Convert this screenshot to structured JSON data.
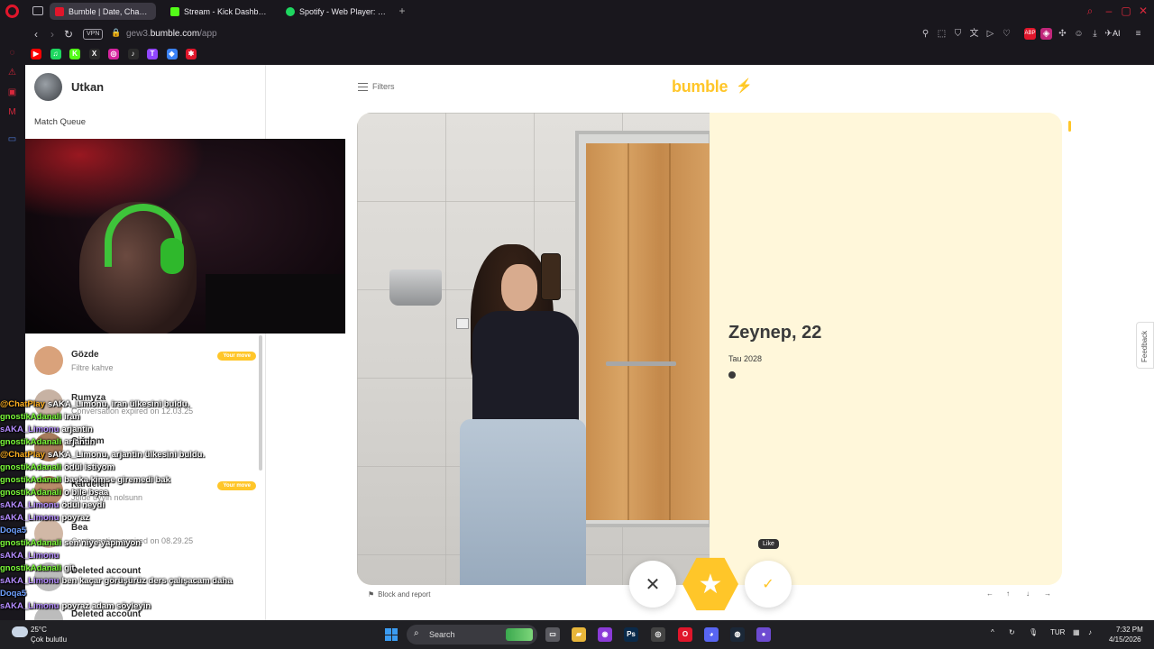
{
  "browser": {
    "tabs": [
      {
        "label": "Bumble | Date, Chat, Meet",
        "favicon_color": "#e0162b",
        "active": true
      },
      {
        "label": "Stream - Kick Dashboard",
        "favicon_color": "#53fc18",
        "active": false
      },
      {
        "label": "Spotify - Web Player: Her",
        "favicon_color": "#1ed760",
        "active": false
      }
    ],
    "vpn_label": "VPN",
    "url_prefix": "gew3.",
    "url_domain": "bumble.com",
    "url_path": "/app",
    "ai_label": "AI",
    "toolbar_icons": [
      "pin-icon",
      "snapshot-icon",
      "shield-icon",
      "translate-icon",
      "play-icon",
      "heart-icon",
      "abp-extension-icon",
      "extension-icon",
      "puzzle-icon",
      "profile-icon",
      "download-icon",
      "aria-icon",
      "menu-icon"
    ],
    "bookmarks": [
      {
        "name": "youtube-icon",
        "color": "#ff0000",
        "glyph": "▶"
      },
      {
        "name": "spotify-icon",
        "color": "#1ed760",
        "glyph": "♫"
      },
      {
        "name": "kick-icon",
        "color": "#53fc18",
        "glyph": "K"
      },
      {
        "name": "x-icon",
        "color": "#2a2a2a",
        "glyph": "X"
      },
      {
        "name": "instagram-icon",
        "color": "#d6249f",
        "glyph": "◎"
      },
      {
        "name": "tiktok-icon",
        "color": "#2a2a2a",
        "glyph": "♪"
      },
      {
        "name": "twitch-icon",
        "color": "#9146ff",
        "glyph": "T"
      },
      {
        "name": "ai-bookmark-icon",
        "color": "#3b82f6",
        "glyph": "◆"
      },
      {
        "name": "app-bookmark-icon",
        "color": "#e0162b",
        "glyph": "✱"
      }
    ]
  },
  "sidebar": {
    "user_name": "Utkan",
    "match_queue_label": "Match Queue",
    "conversations": [
      {
        "name": "Gözde",
        "subtitle": "Filtre kahve",
        "badge": "Your move",
        "avatar_color": "#d9a27b"
      },
      {
        "name": "Rumyza",
        "subtitle": "Conversation expired on 12.03.25",
        "badge": "",
        "avatar_color": "#c7b2a3"
      },
      {
        "name": "Çiğdem",
        "subtitle": "",
        "badge": "",
        "avatar_color": "#a67b5b"
      },
      {
        "name": "Kardelen",
        "subtitle": "Jolde uyyih nolsunn",
        "badge": "Your move",
        "avatar_color": "#b88b6a"
      },
      {
        "name": "Bea",
        "subtitle": "Conversation expired on 08.29.25",
        "badge": "",
        "avatar_color": "#d1b8a6"
      },
      {
        "name": "Deleted account",
        "subtitle": "",
        "badge": "",
        "avatar_color": "#bcbcbc"
      },
      {
        "name": "Deleted account",
        "subtitle": "",
        "badge": "",
        "avatar_color": "#bcbcbc"
      }
    ]
  },
  "chat": [
    {
      "user": "@ChatPlay",
      "color": "#ffb020",
      "msg": "sAKA_Limonu, iran ülkesini buldu."
    },
    {
      "user": "gnostikAdanali",
      "color": "#7cfc3a",
      "msg": "iran"
    },
    {
      "user": "sAKA_Limonu",
      "color": "#b58cff",
      "msg": "arjantin"
    },
    {
      "user": "gnostikAdanali",
      "color": "#7cfc3a",
      "msg": "arjantin"
    },
    {
      "user": "@ChatPlay",
      "color": "#ffb020",
      "msg": "sAKA_Limonu, arjantin ülkesini buldu."
    },
    {
      "user": "gnostikAdanali",
      "color": "#7cfc3a",
      "msg": "ödül istiyom"
    },
    {
      "user": "gnostikAdanali",
      "color": "#7cfc3a",
      "msg": "başka kimse giremedi bak"
    },
    {
      "user": "gnostikAdanali",
      "color": "#7cfc3a",
      "msg": "o bile bşaa"
    },
    {
      "user": "sAKA_Limonu",
      "color": "#b58cff",
      "msg": "ödül neydi"
    },
    {
      "user": "sAKA_Limonu",
      "color": "#b58cff",
      "msg": "poyraz"
    },
    {
      "user": "Doqa5",
      "color": "#6ea0ff",
      "msg": ""
    },
    {
      "user": "gnostikAdanali",
      "color": "#7cfc3a",
      "msg": "sen niye yapmıyon"
    },
    {
      "user": "sAKA_Limonu",
      "color": "#b58cff",
      "msg": ""
    },
    {
      "user": "gnostikAdanali",
      "color": "#7cfc3a",
      "msg": "git"
    },
    {
      "user": "sAKA_Limonu",
      "color": "#b58cff",
      "msg": "ben kaçar görüşürüz ders çalışacam daha"
    },
    {
      "user": "Doqa5",
      "color": "#6ea0ff",
      "msg": ""
    },
    {
      "user": "sAKA_Limonu",
      "color": "#b58cff",
      "msg": "poyraz adam söyleyin"
    }
  ],
  "main": {
    "filters_label": "Filters",
    "logo": "bumble",
    "profile": {
      "name_age": "Zeynep, 22",
      "location": "Tau 2028"
    },
    "block_report_label": "Block and report",
    "nav_hints": [
      "←",
      "↑",
      "↓",
      "→"
    ],
    "actions": {
      "pass_glyph": "✕",
      "superswipe_glyph": "★",
      "like_glyph": "✓",
      "like_tooltip": "Like"
    },
    "feedback_label": "Feedback"
  },
  "taskbar": {
    "temperature": "25°C",
    "condition": "Çok bulutlu",
    "search_label": "Search",
    "apps": [
      {
        "name": "task-view-icon",
        "color": "#5a5a60",
        "glyph": "▭"
      },
      {
        "name": "file-explorer-icon",
        "color": "#e8b63a",
        "glyph": "▰"
      },
      {
        "name": "app-purple-icon",
        "color": "#8b3bd8",
        "glyph": "◉"
      },
      {
        "name": "photoshop-icon",
        "color": "#0a2a4a",
        "glyph": "Ps"
      },
      {
        "name": "chrome-like-icon",
        "color": "#444",
        "glyph": "◎"
      },
      {
        "name": "opera-taskbar-icon",
        "color": "#e0162b",
        "glyph": "O"
      },
      {
        "name": "discord-icon",
        "color": "#5865f2",
        "glyph": "◕"
      },
      {
        "name": "steam-icon",
        "color": "#1b2838",
        "glyph": "◍"
      },
      {
        "name": "obs-icon",
        "color": "#6d4bd1",
        "glyph": "●"
      }
    ],
    "language": "TUR",
    "time": "7:32 PM",
    "date": "4/15/2026"
  }
}
